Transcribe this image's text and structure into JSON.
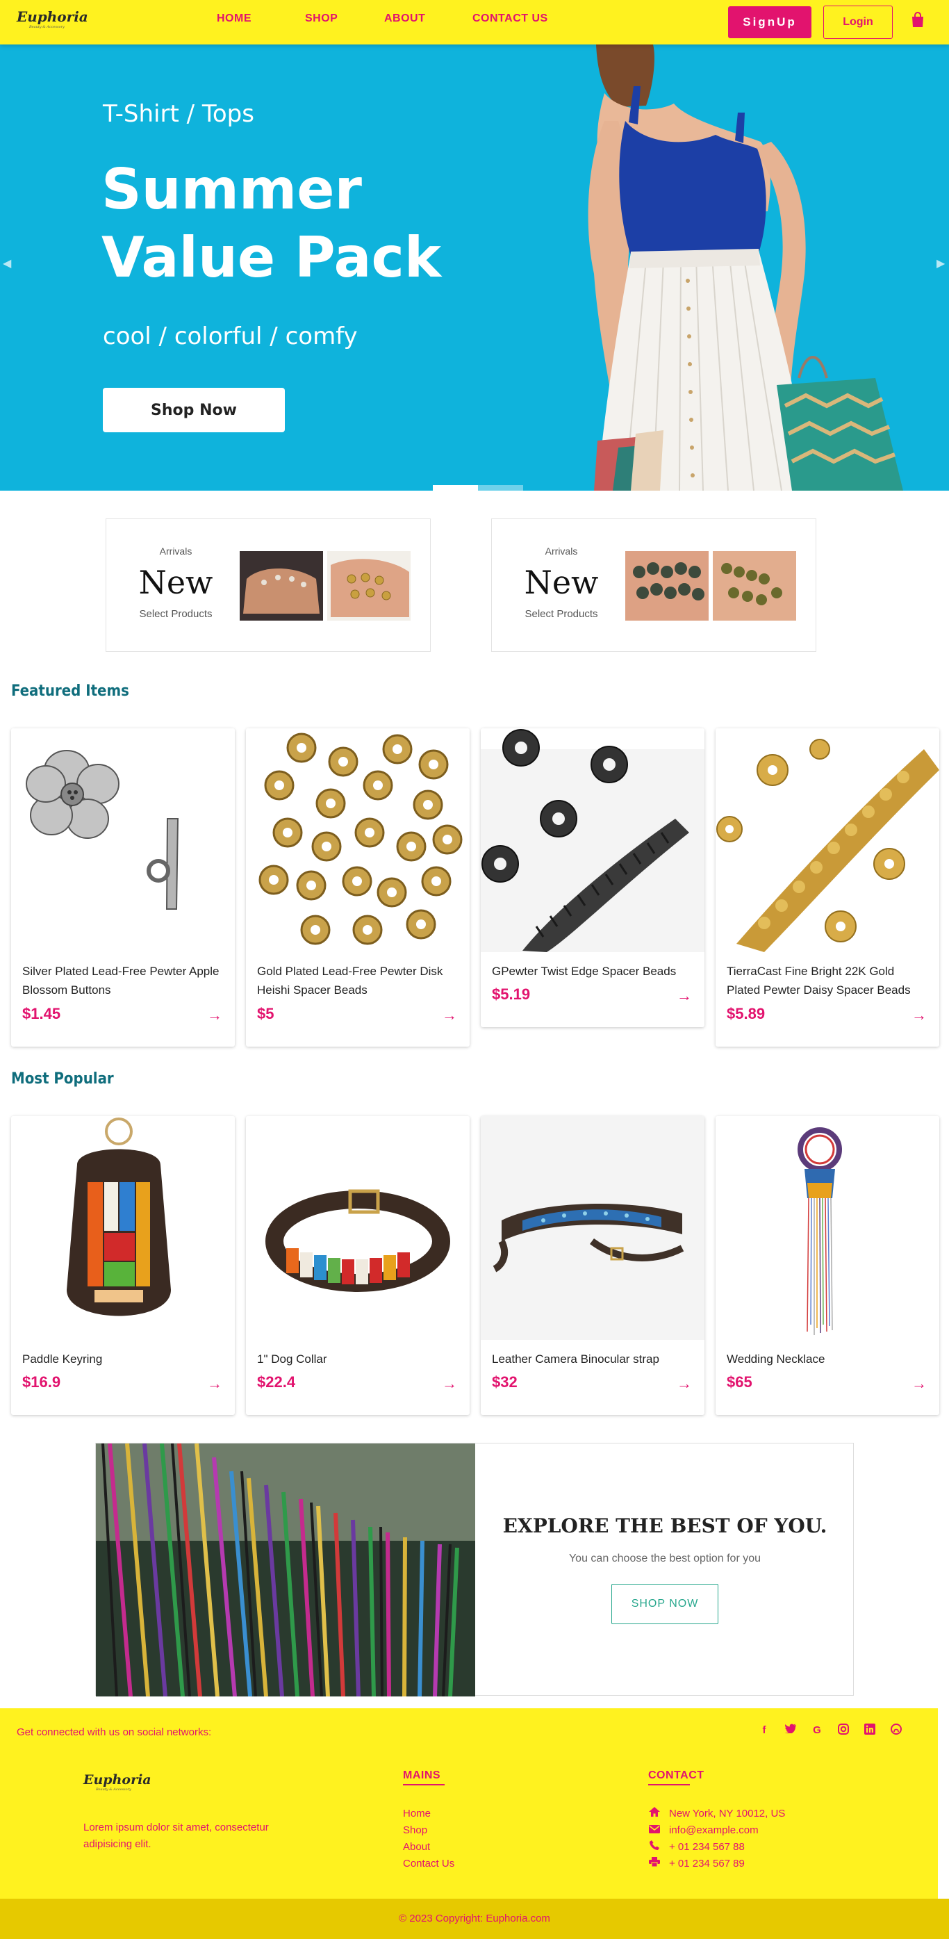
{
  "brand": {
    "name": "Euphoria",
    "tagline": "Beauty & Accessory"
  },
  "nav": {
    "links": [
      "HOME",
      "SHOP",
      "ABOUT",
      "CONTACT US"
    ],
    "signup": "SignUp",
    "login": "Login"
  },
  "hero": {
    "subtitle": "T-Shirt / Tops",
    "title_line1": "Summer",
    "title_line2": "Value Pack",
    "tagline": "cool / colorful / comfy",
    "button": "Shop Now"
  },
  "arrivals": [
    {
      "label": "Arrivals",
      "title": "New",
      "subtitle": "Select Products"
    },
    {
      "label": "Arrivals",
      "title": "New",
      "subtitle": "Select Products"
    }
  ],
  "featured": {
    "title": "Featured Items",
    "items": [
      {
        "name": "Silver Plated Lead-Free Pewter Apple Blossom Buttons",
        "price": "$1.45"
      },
      {
        "name": "Gold Plated Lead-Free Pewter Disk Heishi Spacer Beads",
        "price": "$5"
      },
      {
        "name": "GPewter Twist Edge Spacer Beads",
        "price": "$5.19"
      },
      {
        "name": "TierraCast Fine Bright 22K Gold Plated Pewter Daisy Spacer Beads",
        "price": "$5.89"
      }
    ]
  },
  "popular": {
    "title": "Most Popular",
    "items": [
      {
        "name": "Paddle Keyring",
        "price": "$16.9"
      },
      {
        "name": "1\" Dog Collar",
        "price": "$22.4"
      },
      {
        "name": "Leather Camera Binocular strap",
        "price": "$32"
      },
      {
        "name": "Wedding Necklace",
        "price": "$65"
      }
    ]
  },
  "promo": {
    "title": "EXPLORE THE BEST OF YOU.",
    "subtitle": "You can choose the best option for you",
    "button": "SHOP NOW"
  },
  "footer": {
    "social_text": "Get connected with us on social networks:",
    "about": "Lorem ipsum dolor sit amet, consectetur adipisicing elit.",
    "mains_title": "MAINS",
    "mains": [
      "Home",
      "Shop",
      "About",
      "Contact Us"
    ],
    "contact_title": "CONTACT",
    "contact": [
      "New York, NY 10012, US",
      "info@example.com",
      "+ 01 234 567 88",
      "+ 01 234 567 89"
    ],
    "copyright": "© 2023 Copyright: Euphoria.com"
  },
  "colors": {
    "accent": "#e2136e",
    "nav_bg": "#fff21f",
    "hero_bg": "#0fb3dc",
    "section_title": "#0f6d7c",
    "promo_button": "#27a78d"
  }
}
